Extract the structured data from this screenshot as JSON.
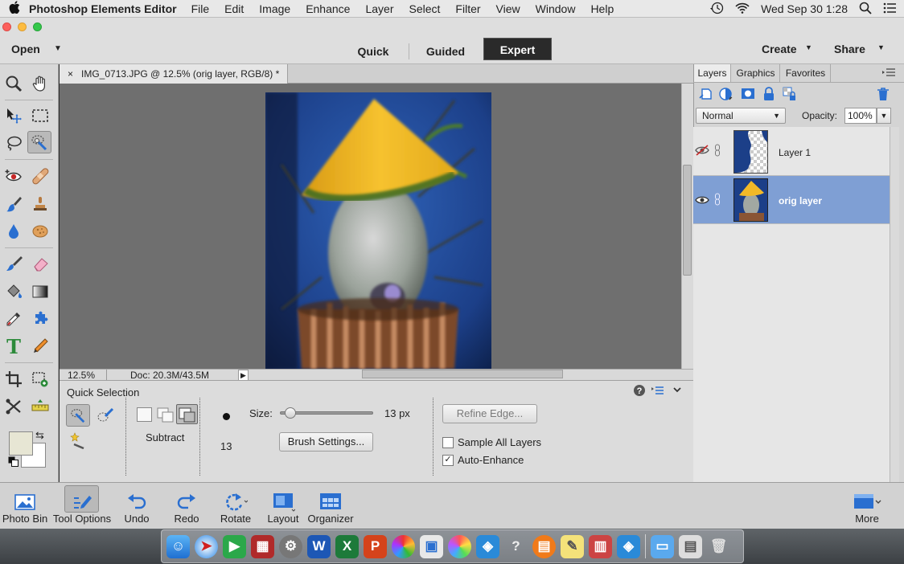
{
  "menubar": {
    "app_name": "Photoshop Elements Editor",
    "menus": [
      "File",
      "Edit",
      "Image",
      "Enhance",
      "Layer",
      "Select",
      "Filter",
      "View",
      "Window",
      "Help"
    ],
    "clock": "Wed Sep 30  1:28"
  },
  "topbar": {
    "open_label": "Open",
    "modes": [
      "Quick",
      "Guided",
      "Expert"
    ],
    "active_mode": "Expert",
    "create_label": "Create",
    "share_label": "Share"
  },
  "document": {
    "tab_close": "×",
    "tab_title": "IMG_0713.JPG @ 12.5% (orig layer, RGB/8) *",
    "zoom": "12.5%",
    "doc_size": "Doc: 20.3M/43.5M"
  },
  "tool_options": {
    "tool_name": "Quick Selection",
    "mode_label": "Subtract",
    "brush_size_value": "13",
    "size_label": "Size:",
    "size_value": "13 px",
    "size_fraction": 0.05,
    "brush_settings_label": "Brush Settings...",
    "refine_edge_label": "Refine Edge...",
    "sample_all_layers_label": "Sample All Layers",
    "sample_all_layers_checked": false,
    "auto_enhance_label": "Auto-Enhance",
    "auto_enhance_checked": true
  },
  "panel": {
    "tabs": [
      "Layers",
      "Graphics",
      "Favorites"
    ],
    "active_tab": "Layers",
    "blend_mode": "Normal",
    "opacity_label": "Opacity:",
    "opacity_value": "100%",
    "layers": [
      {
        "name": "Layer 1",
        "visible": false,
        "selected": false
      },
      {
        "name": "orig layer",
        "visible": true,
        "selected": true
      }
    ]
  },
  "taskbar": {
    "items": [
      "Photo Bin",
      "Tool Options",
      "Undo",
      "Redo",
      "Rotate",
      "Layout",
      "Organizer"
    ],
    "more_label": "More"
  },
  "colors": {
    "expert_bg": "#2a2a2a",
    "selected_layer": "#7f9fd4",
    "foreground_swatch": "#e7e6d4",
    "background_swatch": "#ffffff"
  }
}
